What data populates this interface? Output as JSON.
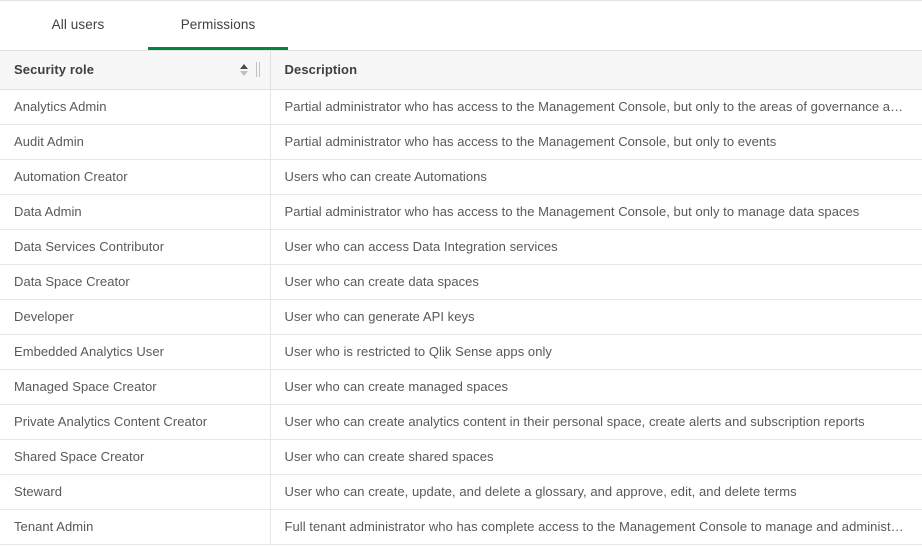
{
  "tabs": [
    {
      "label": "All users",
      "active": false
    },
    {
      "label": "Permissions",
      "active": true
    }
  ],
  "accent_color": "#00873d",
  "table": {
    "columns": [
      {
        "label": "Security role",
        "sortable": true,
        "resizable": true
      },
      {
        "label": "Description",
        "sortable": false,
        "resizable": false
      }
    ],
    "rows": [
      {
        "role": "Analytics Admin",
        "description": "Partial administrator who has access to the Management Console, but only to the areas of governance and content"
      },
      {
        "role": "Audit Admin",
        "description": "Partial administrator who has access to the Management Console, but only to events"
      },
      {
        "role": "Automation Creator",
        "description": "Users who can create Automations"
      },
      {
        "role": "Data Admin",
        "description": "Partial administrator who has access to the Management Console, but only to manage data spaces"
      },
      {
        "role": "Data Services Contributor",
        "description": "User who can access Data Integration services"
      },
      {
        "role": "Data Space Creator",
        "description": "User who can create data spaces"
      },
      {
        "role": "Developer",
        "description": "User who can generate API keys"
      },
      {
        "role": "Embedded Analytics User",
        "description": "User who is restricted to Qlik Sense apps only"
      },
      {
        "role": "Managed Space Creator",
        "description": "User who can create managed spaces"
      },
      {
        "role": "Private Analytics Content Creator",
        "description": "User who can create analytics content in their personal space, create alerts and subscription reports"
      },
      {
        "role": "Shared Space Creator",
        "description": "User who can create shared spaces"
      },
      {
        "role": "Steward",
        "description": "User who can create, update, and delete a glossary, and approve, edit, and delete terms"
      },
      {
        "role": "Tenant Admin",
        "description": "Full tenant administrator who has complete access to the Management Console to manage and administer the tenant"
      }
    ]
  },
  "icons": {
    "sort": "sort-ascending-descending-icon",
    "resize": "column-resize-handle-icon"
  }
}
